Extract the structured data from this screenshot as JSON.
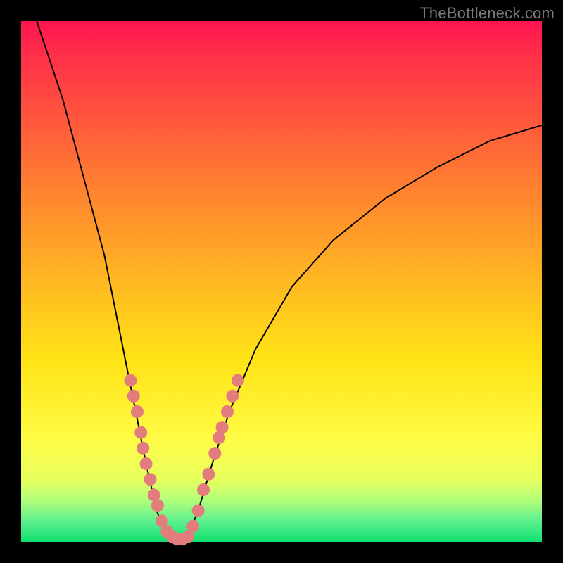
{
  "watermark": "TheBottleneck.com",
  "chart_data": {
    "type": "line",
    "title": "",
    "xlabel": "",
    "ylabel": "",
    "xlim": [
      0,
      100
    ],
    "ylim": [
      0,
      100
    ],
    "grid": false,
    "legend": false,
    "series": [
      {
        "name": "bottleneck-curve",
        "points": [
          {
            "x": 3,
            "y": 100
          },
          {
            "x": 8,
            "y": 85
          },
          {
            "x": 12,
            "y": 70
          },
          {
            "x": 16,
            "y": 55
          },
          {
            "x": 18,
            "y": 45
          },
          {
            "x": 20,
            "y": 35
          },
          {
            "x": 22,
            "y": 25
          },
          {
            "x": 24,
            "y": 15
          },
          {
            "x": 26,
            "y": 6
          },
          {
            "x": 28,
            "y": 1
          },
          {
            "x": 30,
            "y": 0
          },
          {
            "x": 32,
            "y": 1
          },
          {
            "x": 34,
            "y": 6
          },
          {
            "x": 37,
            "y": 16
          },
          {
            "x": 40,
            "y": 25
          },
          {
            "x": 45,
            "y": 37
          },
          {
            "x": 52,
            "y": 49
          },
          {
            "x": 60,
            "y": 58
          },
          {
            "x": 70,
            "y": 66
          },
          {
            "x": 80,
            "y": 72
          },
          {
            "x": 90,
            "y": 77
          },
          {
            "x": 100,
            "y": 80
          }
        ]
      }
    ],
    "highlight_points": [
      {
        "x": 21.0,
        "y": 31
      },
      {
        "x": 21.6,
        "y": 28
      },
      {
        "x": 22.3,
        "y": 25
      },
      {
        "x": 23.0,
        "y": 21
      },
      {
        "x": 23.4,
        "y": 18
      },
      {
        "x": 24.0,
        "y": 15
      },
      {
        "x": 24.8,
        "y": 12
      },
      {
        "x": 25.5,
        "y": 9
      },
      {
        "x": 26.2,
        "y": 7
      },
      {
        "x": 27.0,
        "y": 4
      },
      {
        "x": 28.0,
        "y": 2
      },
      {
        "x": 29.0,
        "y": 1
      },
      {
        "x": 30.0,
        "y": 0.5
      },
      {
        "x": 31.0,
        "y": 0.5
      },
      {
        "x": 32.0,
        "y": 1
      },
      {
        "x": 33.0,
        "y": 3
      },
      {
        "x": 34.0,
        "y": 6
      },
      {
        "x": 35.0,
        "y": 10
      },
      {
        "x": 36.0,
        "y": 13
      },
      {
        "x": 37.2,
        "y": 17
      },
      {
        "x": 38.0,
        "y": 20
      },
      {
        "x": 38.6,
        "y": 22
      },
      {
        "x": 39.6,
        "y": 25
      },
      {
        "x": 40.6,
        "y": 28
      },
      {
        "x": 41.6,
        "y": 31
      }
    ],
    "colors": {
      "curve": "#000000",
      "dot": "#e37c7c",
      "gradient_top": "#ff1450",
      "gradient_bottom": "#10e070",
      "border": "#000000"
    },
    "dot_radius": 9
  }
}
